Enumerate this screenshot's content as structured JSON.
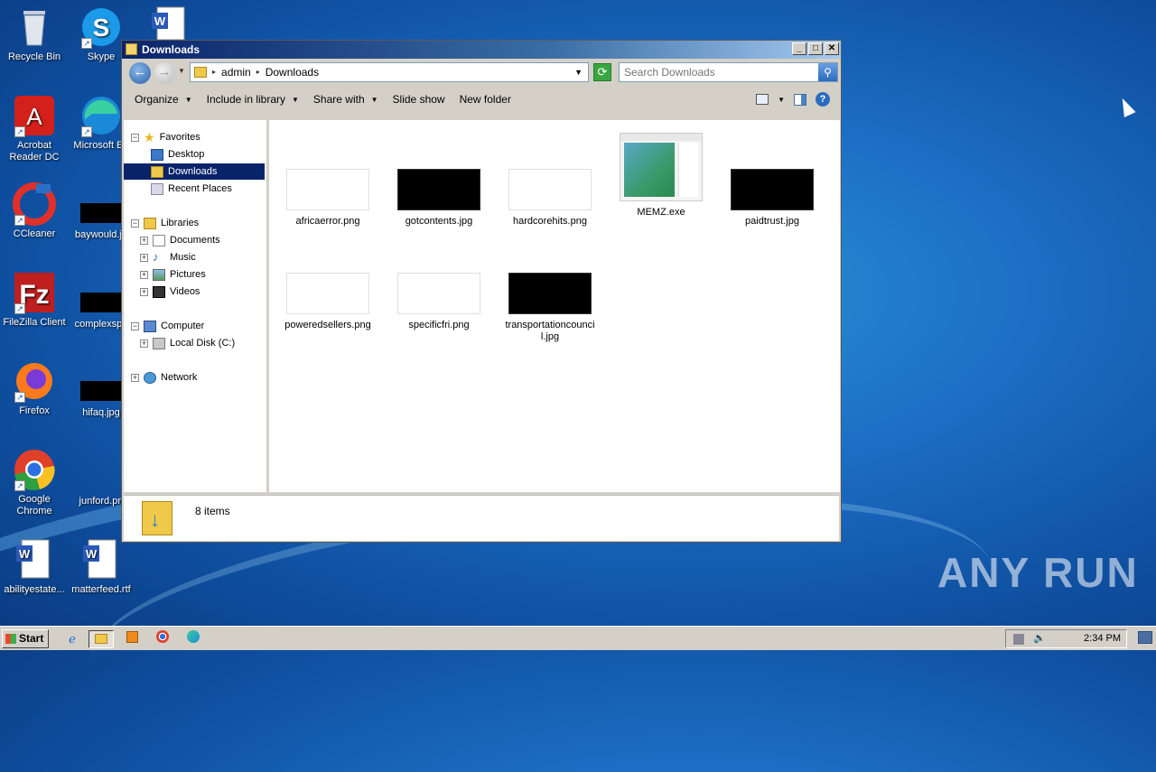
{
  "desktop": {
    "icons": [
      {
        "label": "Recycle Bin",
        "icon": "recycle-bin-icon"
      },
      {
        "label": "Skype",
        "icon": "skype-icon"
      },
      {
        "label": "Acrobat Reader DC",
        "icon": "acrobat-icon"
      },
      {
        "label": "Microsoft Ed",
        "icon": "edge-icon"
      },
      {
        "label": "CCleaner",
        "icon": "ccleaner-icon"
      },
      {
        "label": "baywould.jp",
        "icon": "image-file-icon"
      },
      {
        "label": "FileZilla Client",
        "icon": "filezilla-icon"
      },
      {
        "label": "complexspe",
        "icon": "image-file-icon"
      },
      {
        "label": "Firefox",
        "icon": "firefox-icon"
      },
      {
        "label": "hifaq.jpg",
        "icon": "image-file-icon"
      },
      {
        "label": "Google Chrome",
        "icon": "chrome-icon"
      },
      {
        "label": "junford.pn",
        "icon": "image-file-icon"
      },
      {
        "label": "abilityestate...",
        "icon": "word-document-icon"
      },
      {
        "label": "matterfeed.rtf",
        "icon": "word-document-icon"
      }
    ]
  },
  "window": {
    "title": "Downloads",
    "address": {
      "crumbs": [
        "admin",
        "Downloads"
      ]
    },
    "search": {
      "placeholder": "Search Downloads"
    },
    "toolbar": {
      "organize": "Organize",
      "include_in_library": "Include in library",
      "share_with": "Share with",
      "slide_show": "Slide show",
      "new_folder": "New folder"
    },
    "nav": {
      "favorites": "Favorites",
      "desktop": "Desktop",
      "downloads": "Downloads",
      "recent_places": "Recent Places",
      "libraries": "Libraries",
      "documents": "Documents",
      "music": "Music",
      "pictures": "Pictures",
      "videos": "Videos",
      "computer": "Computer",
      "local_disk": "Local Disk (C:)",
      "network": "Network"
    },
    "files": [
      {
        "name": "africaerror.png"
      },
      {
        "name": "gotcontents.jpg"
      },
      {
        "name": "hardcorehits.png"
      },
      {
        "name": "MEMZ.exe"
      },
      {
        "name": "paidtrust.jpg"
      },
      {
        "name": "poweredsellers.png"
      },
      {
        "name": "specificfri.png"
      },
      {
        "name": "transportationcouncil.jpg"
      }
    ],
    "status": {
      "item_count": "8 items"
    }
  },
  "taskbar": {
    "start_label": "Start",
    "clock": "2:34 PM"
  },
  "watermark": "ANY RUN"
}
